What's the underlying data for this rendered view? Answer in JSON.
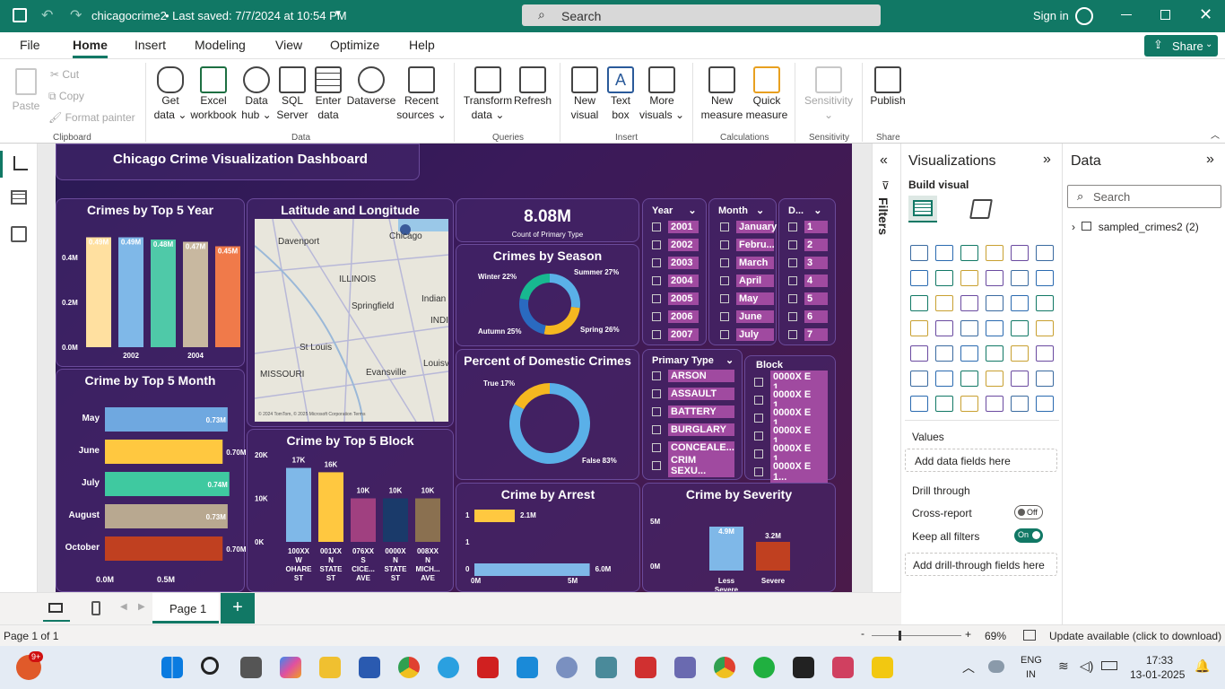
{
  "titlebar": {
    "file": "chicagocrime2",
    "saved": "• Last saved: 7/7/2024 at 10:54 PM",
    "search": "Search",
    "signin": "Sign in"
  },
  "tabs": [
    "File",
    "Home",
    "Insert",
    "Modeling",
    "View",
    "Optimize",
    "Help"
  ],
  "share": "Share",
  "ribbon": {
    "clipboard": {
      "paste": "Paste",
      "cut": "Cut",
      "copy": "Copy",
      "format": "Format painter",
      "group": "Clipboard"
    },
    "data": {
      "get": "Get",
      "get2": "data",
      "excel": "Excel",
      "excel2": "workbook",
      "hub": "Data",
      "hub2": "hub",
      "sql": "SQL",
      "sql2": "Server",
      "enter": "Enter",
      "enter2": "data",
      "dataverse": "Dataverse",
      "recent": "Recent",
      "recent2": "sources",
      "group": "Data"
    },
    "queries": {
      "transform": "Transform",
      "transform2": "data",
      "refresh": "Refresh",
      "group": "Queries"
    },
    "insert": {
      "newvisual": "New",
      "newvisual2": "visual",
      "textbox": "Text",
      "textbox2": "box",
      "more": "More",
      "more2": "visuals",
      "group": "Insert"
    },
    "calc": {
      "newmeasure": "New",
      "newmeasure2": "measure",
      "quick": "Quick",
      "quick2": "measure",
      "group": "Calculations"
    },
    "sens": {
      "label": "Sensitivity",
      "group": "Sensitivity"
    },
    "share": {
      "publish": "Publish",
      "group": "Share"
    }
  },
  "dashboard": {
    "title": "Chicago Crime Visualization Dashboard",
    "year": {
      "title": "Crimes by Top 5 Year",
      "yticks": [
        "0.4M",
        "0.2M",
        "0.0M"
      ],
      "xticks": [
        "2002",
        "2004"
      ],
      "bars": [
        {
          "v": 0.49,
          "label": "0.49M",
          "color": "#ffe0a0"
        },
        {
          "v": 0.49,
          "label": "0.49M",
          "color": "#7fb8e8"
        },
        {
          "v": 0.48,
          "label": "0.48M",
          "color": "#4fc9a8"
        },
        {
          "v": 0.47,
          "label": "0.47M",
          "color": "#c8b8a0"
        },
        {
          "v": 0.45,
          "label": "0.45M",
          "color": "#f07a4a"
        }
      ]
    },
    "map": {
      "title": "Latitude and Longitude",
      "places": [
        "Davenport",
        "Chicago",
        "ILLINOIS",
        "Springfield",
        "Indian",
        "INDI",
        "St Louis",
        "MISSOURI",
        "Evansville",
        "Louisv"
      ],
      "credit": "© 2024 TomTom, © 2025 Microsoft Corporation  Terms"
    },
    "kpi": {
      "value": "8.08M",
      "label": "Count of Primary Type"
    },
    "season": {
      "title": "Crimes by Season",
      "labels": [
        "Winter 22%",
        "Summer 27%",
        "Autumn 25%",
        "Spring 26%"
      ],
      "slices": [
        {
          "name": "Summer",
          "v": 27,
          "color": "#5ab0e8"
        },
        {
          "name": "Spring",
          "v": 26,
          "color": "#f5b820"
        },
        {
          "name": "Autumn",
          "v": 25,
          "color": "#2a6ac0"
        },
        {
          "name": "Winter",
          "v": 22,
          "color": "#18b890"
        }
      ]
    },
    "domestic": {
      "title": "Percent of Domestic Crimes",
      "labels": [
        "True 17%",
        "False 83%"
      ],
      "slices": [
        {
          "name": "False",
          "v": 83,
          "color": "#5ab0e8"
        },
        {
          "name": "True",
          "v": 17,
          "color": "#f5b820"
        }
      ]
    },
    "slicers": {
      "year": {
        "header": "Year",
        "items": [
          "2001",
          "2002",
          "2003",
          "2004",
          "2005",
          "2006",
          "2007"
        ]
      },
      "month": {
        "header": "Month",
        "items": [
          "January",
          "Febru...",
          "March",
          "April",
          "May",
          "June",
          "July"
        ]
      },
      "day": {
        "header": "D...",
        "items": [
          "1",
          "2",
          "3",
          "4",
          "5",
          "6",
          "7"
        ]
      },
      "ptype": {
        "header": "Primary Type",
        "items": [
          "ARSON",
          "ASSAULT",
          "BATTERY",
          "BURGLARY",
          "CONCEALE...",
          "CRIM SEXU..."
        ]
      },
      "block": {
        "header": "Block",
        "items": [
          "0000X E 1...",
          "0000X E 1...",
          "0000X E 1...",
          "0000X E 1...",
          "0000X E 1...",
          "0000X E 1..."
        ]
      }
    },
    "month": {
      "title": "Crime by Top 5 Month",
      "xticks": [
        "0.0M",
        "0.5M"
      ],
      "rows": [
        {
          "name": "May",
          "v": 0.73,
          "label": "0.73M",
          "color": "#6fa8e0"
        },
        {
          "name": "June",
          "v": 0.7,
          "label": "0.70M",
          "color": "#ffc840"
        },
        {
          "name": "July",
          "v": 0.74,
          "label": "0.74M",
          "color": "#3fc9a0"
        },
        {
          "name": "August",
          "v": 0.73,
          "label": "0.73M",
          "color": "#b8a890"
        },
        {
          "name": "October",
          "v": 0.7,
          "label": "0.70M",
          "color": "#c04020"
        }
      ]
    },
    "block": {
      "title": "Crime by Top 5 Block",
      "yticks": [
        "20K",
        "10K",
        "0K"
      ],
      "bars": [
        {
          "v": 17,
          "label": "17K",
          "color": "#7fb8e8",
          "cat": [
            "100XX",
            "W",
            "OHARE",
            "ST"
          ]
        },
        {
          "v": 16,
          "label": "16K",
          "color": "#ffc840",
          "cat": [
            "001XX",
            "N",
            "STATE",
            "ST"
          ]
        },
        {
          "v": 10,
          "label": "10K",
          "color": "#a04080",
          "cat": [
            "076XX",
            "S",
            "CICE...",
            "AVE"
          ]
        },
        {
          "v": 10,
          "label": "10K",
          "color": "#1a3a6a",
          "cat": [
            "0000X",
            "N",
            "STATE",
            "ST"
          ]
        },
        {
          "v": 10,
          "label": "10K",
          "color": "#8a7050",
          "cat": [
            "008XX",
            "N",
            "MICH...",
            "AVE"
          ]
        }
      ]
    },
    "arrest": {
      "title": "Crime by Arrest",
      "rows": [
        {
          "name": "1",
          "v": 2.1,
          "label": "2.1M",
          "color": "#ffc840"
        },
        {
          "name": "1",
          "v": 0,
          "label": "",
          "color": "none"
        },
        {
          "name": "0",
          "v": 6.0,
          "label": "6.0M",
          "color": "#7fb8e8"
        }
      ],
      "xticks": [
        "0M",
        "5M"
      ]
    },
    "severity": {
      "title": "Crime by Severity",
      "yticks": [
        "5M",
        "0M"
      ],
      "bars": [
        {
          "v": 4.9,
          "label": "4.9M",
          "color": "#7fb8e8",
          "cat": [
            "Less",
            "Severe"
          ]
        },
        {
          "v": 3.2,
          "label": "3.2M",
          "color": "#c04020",
          "cat": [
            "Severe"
          ]
        }
      ]
    }
  },
  "filters": "Filters",
  "viz": {
    "title": "Visualizations",
    "build": "Build visual",
    "values": "Values",
    "add": "Add data fields here",
    "drill": "Drill through",
    "cross": "Cross-report",
    "cross_state": "Off",
    "keep": "Keep all filters",
    "keep_state": "On",
    "adddrill": "Add drill-through fields here"
  },
  "datapane": {
    "title": "Data",
    "search": "Search",
    "table": "sampled_crimes2 (2)"
  },
  "page": {
    "tab": "Page 1"
  },
  "status": {
    "page": "Page 1 of 1",
    "zoom": "69%",
    "update": "Update available (click to download)"
  },
  "taskbar": {
    "badge": "9+",
    "lang1": "ENG",
    "lang2": "IN",
    "time": "17:33",
    "date": "13-01-2025"
  }
}
